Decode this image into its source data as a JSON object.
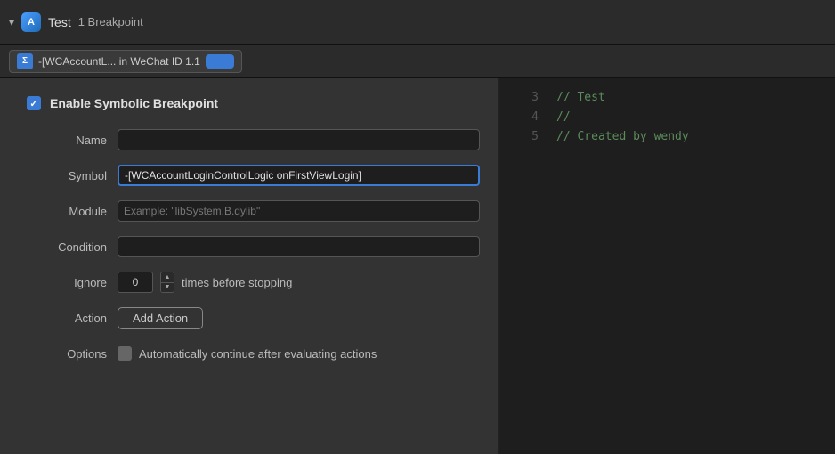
{
  "topbar": {
    "chevron": "▾",
    "project_name": "Test",
    "breakpoint_count": "1 Breakpoint"
  },
  "breakpoint_row": {
    "label": "-[WCAccountL... in WeChat ID 1.1"
  },
  "form": {
    "enable_label": "Enable Symbolic Breakpoint",
    "name_label": "Name",
    "name_value": "",
    "name_placeholder": "",
    "symbol_label": "Symbol",
    "symbol_value": "-[WCAccountLoginControlLogic onFirstViewLogin]",
    "module_label": "Module",
    "module_placeholder": "Example: \"libSystem.B.dylib\"",
    "condition_label": "Condition",
    "condition_value": "",
    "ignore_label": "Ignore",
    "ignore_value": "0",
    "ignore_suffix": "times before stopping",
    "action_label": "Action",
    "add_action_label": "Add Action",
    "options_label": "Options",
    "options_text": "Automatically continue after evaluating actions"
  },
  "code": {
    "lines": [
      {
        "number": "3",
        "content": "// Test"
      },
      {
        "number": "4",
        "content": "//"
      },
      {
        "number": "5",
        "content": "// Created by wendy"
      }
    ]
  }
}
